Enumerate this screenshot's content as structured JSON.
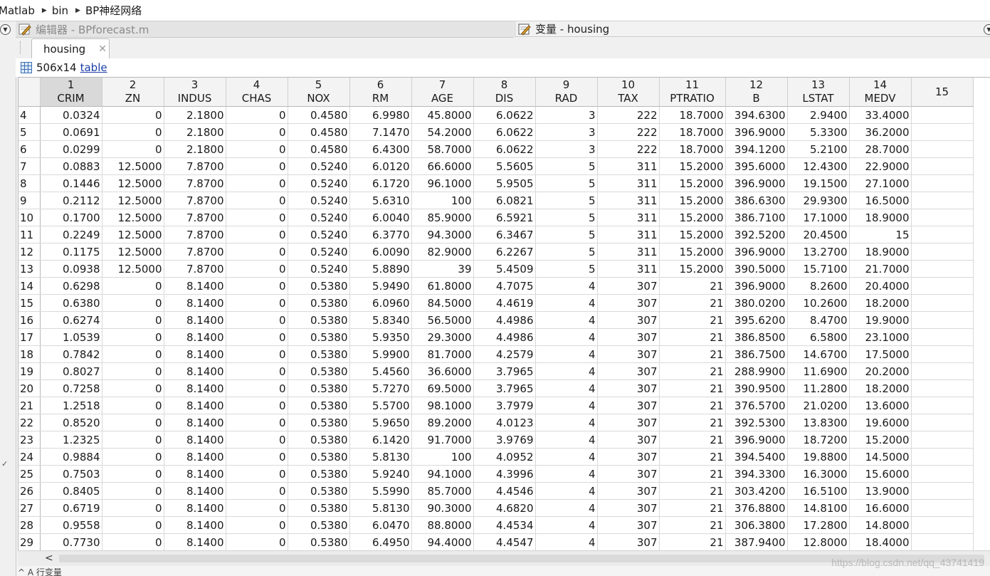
{
  "breadcrumb": [
    "Matlab",
    "bin",
    "BP神经网络"
  ],
  "editor_tab": {
    "label": "编辑器 - BPforecast.m"
  },
  "variable_tab": {
    "label": "变量 - housing"
  },
  "doc_tab": {
    "label": "housing",
    "close": "✕"
  },
  "info": {
    "size": "506x14",
    "type_link": "table"
  },
  "grid": {
    "columns": [
      {
        "index": "1",
        "name": "CRIM"
      },
      {
        "index": "2",
        "name": "ZN"
      },
      {
        "index": "3",
        "name": "INDUS"
      },
      {
        "index": "4",
        "name": "CHAS"
      },
      {
        "index": "5",
        "name": "NOX"
      },
      {
        "index": "6",
        "name": "RM"
      },
      {
        "index": "7",
        "name": "AGE"
      },
      {
        "index": "8",
        "name": "DIS"
      },
      {
        "index": "9",
        "name": "RAD"
      },
      {
        "index": "10",
        "name": "TAX"
      },
      {
        "index": "11",
        "name": "PTRATIO"
      },
      {
        "index": "12",
        "name": "B"
      },
      {
        "index": "13",
        "name": "LSTAT"
      },
      {
        "index": "14",
        "name": "MEDV"
      },
      {
        "index": "15",
        "name": ""
      }
    ],
    "rows": [
      {
        "n": "4",
        "cells": [
          "0.0324",
          "0",
          "2.1800",
          "0",
          "0.4580",
          "6.9980",
          "45.8000",
          "6.0622",
          "3",
          "222",
          "18.7000",
          "394.6300",
          "2.9400",
          "33.4000"
        ]
      },
      {
        "n": "5",
        "cells": [
          "0.0691",
          "0",
          "2.1800",
          "0",
          "0.4580",
          "7.1470",
          "54.2000",
          "6.0622",
          "3",
          "222",
          "18.7000",
          "396.9000",
          "5.3300",
          "36.2000"
        ]
      },
      {
        "n": "6",
        "cells": [
          "0.0299",
          "0",
          "2.1800",
          "0",
          "0.4580",
          "6.4300",
          "58.7000",
          "6.0622",
          "3",
          "222",
          "18.7000",
          "394.1200",
          "5.2100",
          "28.7000"
        ]
      },
      {
        "n": "7",
        "cells": [
          "0.0883",
          "12.5000",
          "7.8700",
          "0",
          "0.5240",
          "6.0120",
          "66.6000",
          "5.5605",
          "5",
          "311",
          "15.2000",
          "395.6000",
          "12.4300",
          "22.9000"
        ]
      },
      {
        "n": "8",
        "cells": [
          "0.1446",
          "12.5000",
          "7.8700",
          "0",
          "0.5240",
          "6.1720",
          "96.1000",
          "5.9505",
          "5",
          "311",
          "15.2000",
          "396.9000",
          "19.1500",
          "27.1000"
        ]
      },
      {
        "n": "9",
        "cells": [
          "0.2112",
          "12.5000",
          "7.8700",
          "0",
          "0.5240",
          "5.6310",
          "100",
          "6.0821",
          "5",
          "311",
          "15.2000",
          "386.6300",
          "29.9300",
          "16.5000"
        ]
      },
      {
        "n": "10",
        "cells": [
          "0.1700",
          "12.5000",
          "7.8700",
          "0",
          "0.5240",
          "6.0040",
          "85.9000",
          "6.5921",
          "5",
          "311",
          "15.2000",
          "386.7100",
          "17.1000",
          "18.9000"
        ]
      },
      {
        "n": "11",
        "cells": [
          "0.2249",
          "12.5000",
          "7.8700",
          "0",
          "0.5240",
          "6.3770",
          "94.3000",
          "6.3467",
          "5",
          "311",
          "15.2000",
          "392.5200",
          "20.4500",
          "15"
        ]
      },
      {
        "n": "12",
        "cells": [
          "0.1175",
          "12.5000",
          "7.8700",
          "0",
          "0.5240",
          "6.0090",
          "82.9000",
          "6.2267",
          "5",
          "311",
          "15.2000",
          "396.9000",
          "13.2700",
          "18.9000"
        ]
      },
      {
        "n": "13",
        "cells": [
          "0.0938",
          "12.5000",
          "7.8700",
          "0",
          "0.5240",
          "5.8890",
          "39",
          "5.4509",
          "5",
          "311",
          "15.2000",
          "390.5000",
          "15.7100",
          "21.7000"
        ]
      },
      {
        "n": "14",
        "cells": [
          "0.6298",
          "0",
          "8.1400",
          "0",
          "0.5380",
          "5.9490",
          "61.8000",
          "4.7075",
          "4",
          "307",
          "21",
          "396.9000",
          "8.2600",
          "20.4000"
        ]
      },
      {
        "n": "15",
        "cells": [
          "0.6380",
          "0",
          "8.1400",
          "0",
          "0.5380",
          "6.0960",
          "84.5000",
          "4.4619",
          "4",
          "307",
          "21",
          "380.0200",
          "10.2600",
          "18.2000"
        ]
      },
      {
        "n": "16",
        "cells": [
          "0.6274",
          "0",
          "8.1400",
          "0",
          "0.5380",
          "5.8340",
          "56.5000",
          "4.4986",
          "4",
          "307",
          "21",
          "395.6200",
          "8.4700",
          "19.9000"
        ]
      },
      {
        "n": "17",
        "cells": [
          "1.0539",
          "0",
          "8.1400",
          "0",
          "0.5380",
          "5.9350",
          "29.3000",
          "4.4986",
          "4",
          "307",
          "21",
          "386.8500",
          "6.5800",
          "23.1000"
        ]
      },
      {
        "n": "18",
        "cells": [
          "0.7842",
          "0",
          "8.1400",
          "0",
          "0.5380",
          "5.9900",
          "81.7000",
          "4.2579",
          "4",
          "307",
          "21",
          "386.7500",
          "14.6700",
          "17.5000"
        ]
      },
      {
        "n": "19",
        "cells": [
          "0.8027",
          "0",
          "8.1400",
          "0",
          "0.5380",
          "5.4560",
          "36.6000",
          "3.7965",
          "4",
          "307",
          "21",
          "288.9900",
          "11.6900",
          "20.2000"
        ]
      },
      {
        "n": "20",
        "cells": [
          "0.7258",
          "0",
          "8.1400",
          "0",
          "0.5380",
          "5.7270",
          "69.5000",
          "3.7965",
          "4",
          "307",
          "21",
          "390.9500",
          "11.2800",
          "18.2000"
        ]
      },
      {
        "n": "21",
        "cells": [
          "1.2518",
          "0",
          "8.1400",
          "0",
          "0.5380",
          "5.5700",
          "98.1000",
          "3.7979",
          "4",
          "307",
          "21",
          "376.5700",
          "21.0200",
          "13.6000"
        ]
      },
      {
        "n": "22",
        "cells": [
          "0.8520",
          "0",
          "8.1400",
          "0",
          "0.5380",
          "5.9650",
          "89.2000",
          "4.0123",
          "4",
          "307",
          "21",
          "392.5300",
          "13.8300",
          "19.6000"
        ]
      },
      {
        "n": "23",
        "cells": [
          "1.2325",
          "0",
          "8.1400",
          "0",
          "0.5380",
          "6.1420",
          "91.7000",
          "3.9769",
          "4",
          "307",
          "21",
          "396.9000",
          "18.7200",
          "15.2000"
        ]
      },
      {
        "n": "24",
        "cells": [
          "0.9884",
          "0",
          "8.1400",
          "0",
          "0.5380",
          "5.8130",
          "100",
          "4.0952",
          "4",
          "307",
          "21",
          "394.5400",
          "19.8800",
          "14.5000"
        ]
      },
      {
        "n": "25",
        "cells": [
          "0.7503",
          "0",
          "8.1400",
          "0",
          "0.5380",
          "5.9240",
          "94.1000",
          "4.3996",
          "4",
          "307",
          "21",
          "394.3300",
          "16.3000",
          "15.6000"
        ]
      },
      {
        "n": "26",
        "cells": [
          "0.8405",
          "0",
          "8.1400",
          "0",
          "0.5380",
          "5.5990",
          "85.7000",
          "4.4546",
          "4",
          "307",
          "21",
          "303.4200",
          "16.5100",
          "13.9000"
        ]
      },
      {
        "n": "27",
        "cells": [
          "0.6719",
          "0",
          "8.1400",
          "0",
          "0.5380",
          "5.8130",
          "90.3000",
          "4.6820",
          "4",
          "307",
          "21",
          "376.8800",
          "14.8100",
          "16.6000"
        ]
      },
      {
        "n": "28",
        "cells": [
          "0.9558",
          "0",
          "8.1400",
          "0",
          "0.5380",
          "6.0470",
          "88.8000",
          "4.4534",
          "4",
          "307",
          "21",
          "306.3800",
          "17.2800",
          "14.8000"
        ]
      },
      {
        "n": "29",
        "cells": [
          "0.7730",
          "0",
          "8.1400",
          "0",
          "0.5380",
          "6.4950",
          "94.4000",
          "4.4547",
          "4",
          "307",
          "21",
          "387.9400",
          "12.8000",
          "18.4000"
        ]
      }
    ]
  },
  "status": {
    "text": "^ A 行变量"
  },
  "watermark": "https://blog.csdn.net/qq_43741419"
}
